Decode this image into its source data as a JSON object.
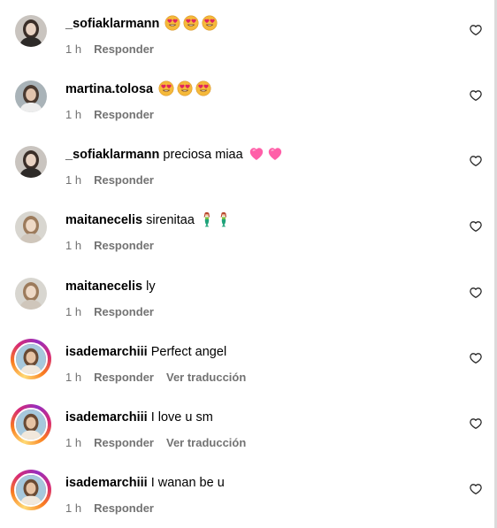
{
  "colors": {
    "meta_text": "#737373",
    "story_ring_start": "#feda75",
    "story_ring_end": "#d62976",
    "heart_emoji": "#ff5fa8",
    "divider": "#dbdbdb"
  },
  "icons": {
    "like": "heart-outline-icon",
    "emoji_heart_eyes": "smiling-face-with-heart-eyes",
    "emoji_pink_heart": "pink-heart",
    "emoji_mermaid": "mermaid"
  },
  "comments": [
    {
      "username": "_sofiaklarmann",
      "text": "",
      "emojis": [
        "heart-eyes",
        "heart-eyes",
        "heart-eyes"
      ],
      "time": "1 h",
      "reply_label": "Responder",
      "translate_label": "",
      "story_ring": false
    },
    {
      "username": "martina.tolosa",
      "text": "",
      "emojis": [
        "heart-eyes",
        "heart-eyes",
        "heart-eyes"
      ],
      "time": "1 h",
      "reply_label": "Responder",
      "translate_label": "",
      "story_ring": false
    },
    {
      "username": "_sofiaklarmann",
      "text": "preciosa miaa",
      "emojis": [
        "pink-heart",
        "pink-heart"
      ],
      "time": "1 h",
      "reply_label": "Responder",
      "translate_label": "",
      "story_ring": false
    },
    {
      "username": "maitanecelis",
      "text": "sirenitaa",
      "emojis": [
        "mermaid",
        "mermaid"
      ],
      "time": "1 h",
      "reply_label": "Responder",
      "translate_label": "",
      "story_ring": false
    },
    {
      "username": "maitanecelis",
      "text": "ly",
      "emojis": [],
      "time": "1 h",
      "reply_label": "Responder",
      "translate_label": "",
      "story_ring": false
    },
    {
      "username": "isademarchiii",
      "text": "Perfect angel",
      "emojis": [],
      "time": "1 h",
      "reply_label": "Responder",
      "translate_label": "Ver traducción",
      "story_ring": true
    },
    {
      "username": "isademarchiii",
      "text": "I love u sm",
      "emojis": [],
      "time": "1 h",
      "reply_label": "Responder",
      "translate_label": "Ver traducción",
      "story_ring": true
    },
    {
      "username": "isademarchiii",
      "text": "I wanan be u",
      "emojis": [],
      "time": "1 h",
      "reply_label": "Responder",
      "translate_label": "",
      "story_ring": true
    }
  ]
}
